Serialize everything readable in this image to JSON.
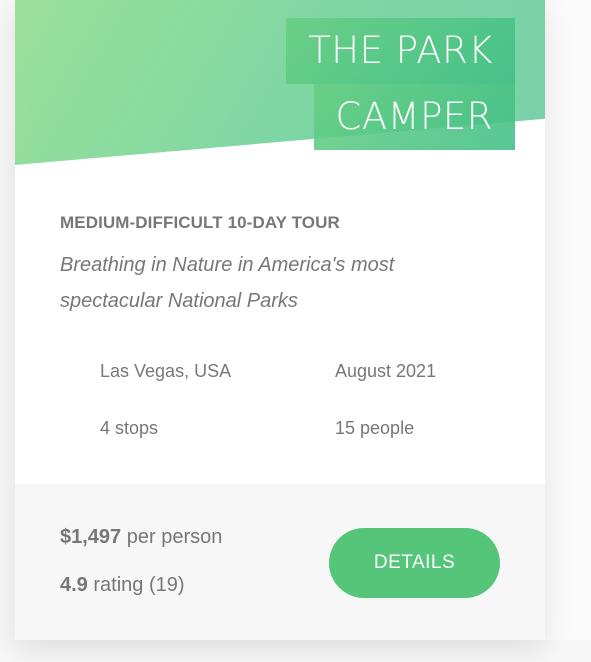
{
  "card": {
    "heading_line1": "THE PARK",
    "heading_line2": "CAMPER",
    "sub_heading": "MEDIUM-DIFFICULT 10-DAY TOUR",
    "description": "Breathing in Nature in America's most spectacular National Parks",
    "facts": {
      "location": "Las Vegas, USA",
      "date": "August 2021",
      "stops": "4 stops",
      "people": "15 people"
    },
    "footer": {
      "price_value": "$1,497",
      "price_unit": "per person",
      "rating_value": "4.9",
      "rating_text": "rating (19)",
      "button_label": "DETAILS"
    }
  },
  "colors": {
    "accent_green": "#55c57a",
    "header_gradient_start": "#9be09a",
    "header_gradient_end": "#79d0a9",
    "text_gray": "#777777",
    "footer_bg": "#f7f7f7"
  }
}
